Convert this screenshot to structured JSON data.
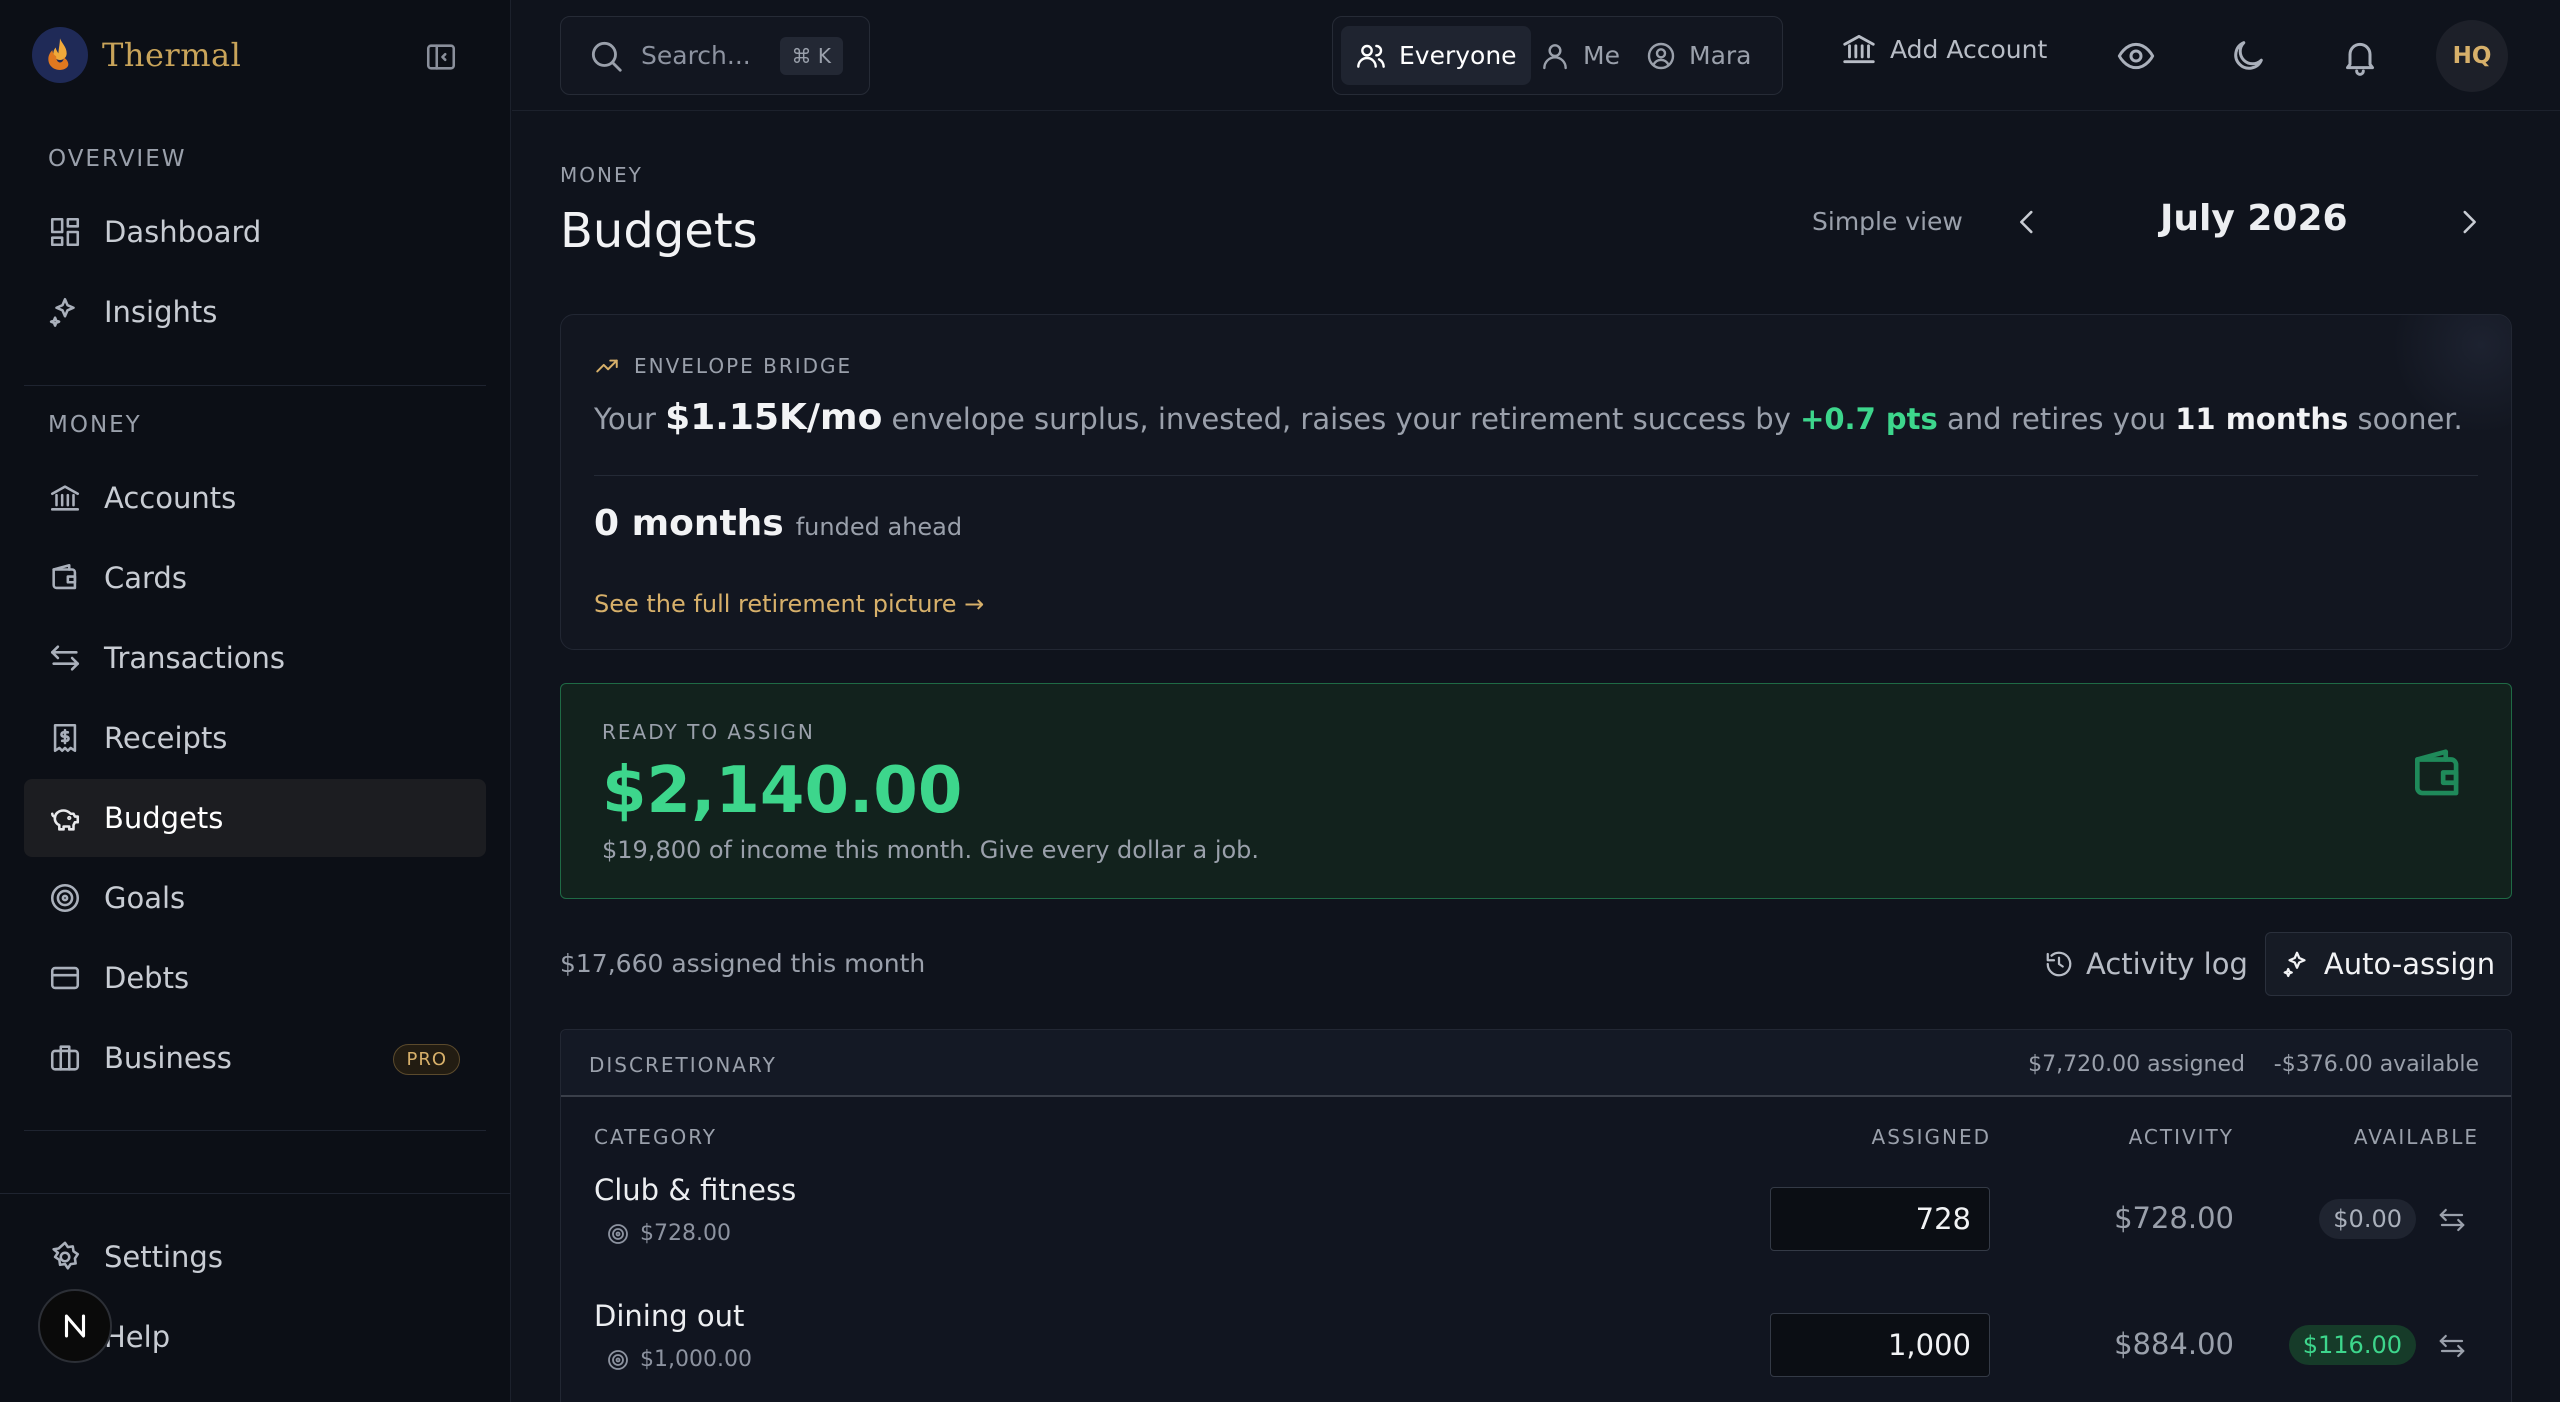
{
  "brand": {
    "name": "Thermal"
  },
  "sidebar": {
    "sections": [
      {
        "label": "OVERVIEW"
      },
      {
        "label": "MONEY"
      }
    ],
    "items": [
      {
        "label": "Dashboard",
        "icon": "dashboard-icon"
      },
      {
        "label": "Insights",
        "icon": "sparkles-icon"
      },
      {
        "label": "Accounts",
        "icon": "bank-icon"
      },
      {
        "label": "Cards",
        "icon": "wallet-icon"
      },
      {
        "label": "Transactions",
        "icon": "arrows-swap-icon"
      },
      {
        "label": "Receipts",
        "icon": "receipt-icon"
      },
      {
        "label": "Budgets",
        "icon": "piggy-bank-icon",
        "active": true
      },
      {
        "label": "Goals",
        "icon": "target-icon"
      },
      {
        "label": "Debts",
        "icon": "credit-card-icon"
      },
      {
        "label": "Business",
        "icon": "briefcase-icon",
        "badge": "PRO"
      },
      {
        "label": "Settings",
        "icon": "gear-icon"
      },
      {
        "label": "Help",
        "icon": "help-icon"
      }
    ]
  },
  "topbar": {
    "search_placeholder": "Search...",
    "search_shortcut": "⌘ K",
    "scope": [
      {
        "label": "Everyone",
        "active": true
      },
      {
        "label": "Me"
      },
      {
        "label": "Mara"
      }
    ],
    "add_account": "Add Account",
    "avatar_initials": "HQ"
  },
  "page": {
    "eyebrow": "MONEY",
    "title": "Budgets",
    "view_toggle": "Simple view",
    "month": "July 2026"
  },
  "bridge": {
    "heading": "ENVELOPE BRIDGE",
    "sentence": {
      "pre": "Your",
      "amount": "$1.15K/mo",
      "mid": "envelope surplus, invested, raises your retirement success by",
      "points": "+0.7 pts",
      "mid2": "and retires you",
      "months": "11 months",
      "post": "sooner."
    },
    "months_funded": "0 months",
    "months_funded_label": "funded ahead",
    "link": "See the full retirement picture →"
  },
  "ready": {
    "label": "READY TO ASSIGN",
    "amount": "$2,140.00",
    "subtitle": "$19,800 of income this month. Give every dollar a job."
  },
  "toolbar": {
    "assigned_summary": "$17,660 assigned this month",
    "activity_log": "Activity log",
    "auto_assign": "Auto-assign"
  },
  "group": {
    "name": "DISCRETIONARY",
    "assigned": "$7,720.00 assigned",
    "available": "-$376.00 available",
    "columns": {
      "category": "CATEGORY",
      "assigned": "ASSIGNED",
      "activity": "ACTIVITY",
      "available": "AVAILABLE"
    },
    "rows": [
      {
        "name": "Club & fitness",
        "goal": "$728.00",
        "assigned": "728",
        "activity": "$728.00",
        "available": "$0.00",
        "status": "zero"
      },
      {
        "name": "Dining out",
        "goal": "$1,000.00",
        "assigned": "1,000",
        "activity": "$884.00",
        "available": "$116.00",
        "status": "positive"
      }
    ]
  },
  "colors": {
    "accent_gold": "#d7b06a",
    "positive_green": "#3dd68c",
    "background": "#0f131c",
    "sidebar_bg": "#0c0f16"
  }
}
